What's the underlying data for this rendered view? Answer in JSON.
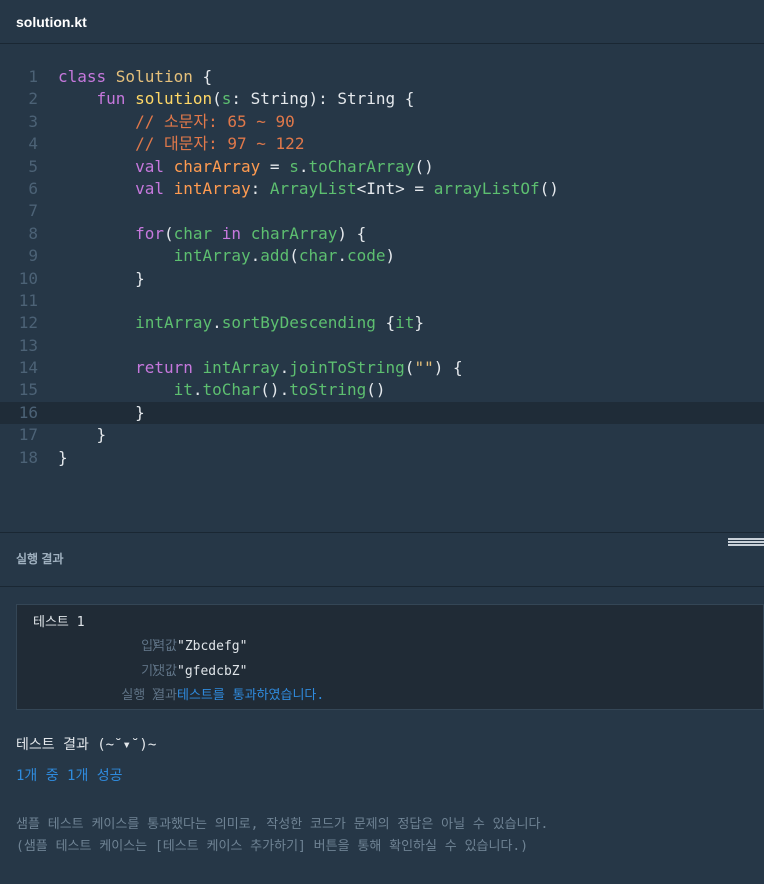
{
  "header": {
    "file_name": "solution.kt"
  },
  "editor": {
    "active_line": "16",
    "line_numbers": [
      "1",
      "2",
      "3",
      "4",
      "5",
      "6",
      "7",
      "8",
      "9",
      "10",
      "11",
      "12",
      "13",
      "14",
      "15",
      "16",
      "17",
      "18"
    ],
    "lines": [
      [
        {
          "t": "class ",
          "c": "kw"
        },
        {
          "t": "Solution",
          "c": "cls"
        },
        {
          "t": " {",
          "c": ""
        }
      ],
      [
        {
          "t": "    ",
          "c": ""
        },
        {
          "t": "fun ",
          "c": "kw"
        },
        {
          "t": "solution",
          "c": "fn"
        },
        {
          "t": "(",
          "c": ""
        },
        {
          "t": "s",
          "c": "mth"
        },
        {
          "t": ": String): String {",
          "c": ""
        }
      ],
      [
        {
          "t": "        // 소문자: 65 ~ 90",
          "c": "cmt"
        }
      ],
      [
        {
          "t": "        // 대문자: 97 ~ 122",
          "c": "cmt"
        }
      ],
      [
        {
          "t": "        ",
          "c": ""
        },
        {
          "t": "val ",
          "c": "kw"
        },
        {
          "t": "charArray",
          "c": "var"
        },
        {
          "t": " = ",
          "c": ""
        },
        {
          "t": "s",
          "c": "mth"
        },
        {
          "t": ".",
          "c": ""
        },
        {
          "t": "toCharArray",
          "c": "mth"
        },
        {
          "t": "()",
          "c": ""
        }
      ],
      [
        {
          "t": "        ",
          "c": ""
        },
        {
          "t": "val ",
          "c": "kw"
        },
        {
          "t": "intArray",
          "c": "var"
        },
        {
          "t": ": ",
          "c": ""
        },
        {
          "t": "ArrayList",
          "c": "mth"
        },
        {
          "t": "<Int> = ",
          "c": ""
        },
        {
          "t": "arrayListOf",
          "c": "mth"
        },
        {
          "t": "()",
          "c": ""
        }
      ],
      [],
      [
        {
          "t": "        ",
          "c": ""
        },
        {
          "t": "for",
          "c": "kw"
        },
        {
          "t": "(",
          "c": ""
        },
        {
          "t": "char ",
          "c": "mth"
        },
        {
          "t": "in ",
          "c": "kw"
        },
        {
          "t": "charArray",
          "c": "mth"
        },
        {
          "t": ") {",
          "c": ""
        }
      ],
      [
        {
          "t": "            ",
          "c": ""
        },
        {
          "t": "intArray",
          "c": "mth"
        },
        {
          "t": ".",
          "c": ""
        },
        {
          "t": "add",
          "c": "mth"
        },
        {
          "t": "(",
          "c": ""
        },
        {
          "t": "char",
          "c": "mth"
        },
        {
          "t": ".",
          "c": ""
        },
        {
          "t": "code",
          "c": "mth"
        },
        {
          "t": ")",
          "c": ""
        }
      ],
      [
        {
          "t": "        }",
          "c": ""
        }
      ],
      [],
      [
        {
          "t": "        ",
          "c": ""
        },
        {
          "t": "intArray",
          "c": "mth"
        },
        {
          "t": ".",
          "c": ""
        },
        {
          "t": "sortByDescending",
          "c": "mth"
        },
        {
          "t": " {",
          "c": ""
        },
        {
          "t": "it",
          "c": "mth"
        },
        {
          "t": "}",
          "c": ""
        }
      ],
      [],
      [
        {
          "t": "        ",
          "c": ""
        },
        {
          "t": "return ",
          "c": "kw"
        },
        {
          "t": "intArray",
          "c": "mth"
        },
        {
          "t": ".",
          "c": ""
        },
        {
          "t": "joinToString",
          "c": "mth"
        },
        {
          "t": "(",
          "c": ""
        },
        {
          "t": "\"\"",
          "c": "str"
        },
        {
          "t": ") {",
          "c": ""
        }
      ],
      [
        {
          "t": "            ",
          "c": ""
        },
        {
          "t": "it",
          "c": "mth"
        },
        {
          "t": ".",
          "c": ""
        },
        {
          "t": "toChar",
          "c": "mth"
        },
        {
          "t": "().",
          "c": ""
        },
        {
          "t": "toString",
          "c": "mth"
        },
        {
          "t": "()",
          "c": ""
        }
      ],
      [
        {
          "t": "        }",
          "c": ""
        }
      ],
      [
        {
          "t": "    }",
          "c": ""
        }
      ],
      [
        {
          "t": "}",
          "c": ""
        }
      ]
    ],
    "colors": {
      "keyword": "#c678dd",
      "class": "#e5c07b",
      "function": "#ffd866",
      "comment": "#e0784a",
      "method": "#5dbf70",
      "variable": "#ff9b50"
    }
  },
  "results_panel": {
    "title": "실행 결과",
    "test_case": {
      "title": "테스트 1",
      "rows": [
        {
          "label": "입력값",
          "value": "\"Zbcdefg\""
        },
        {
          "label": "기댓값",
          "value": "\"gfedcbZ\""
        },
        {
          "label": "실행 결과",
          "value": "테스트를 통과하였습니다."
        }
      ]
    },
    "result_title": "테스트 결과 (~˘▾˘)~",
    "result_summary": "1개 중 1개 성공",
    "notes": [
      "샘플 테스트 케이스를 통과했다는 의미로, 작성한 코드가 문제의 정답은 아닐 수 있습니다.",
      "(샘플 테스트 케이스는 [테스트 케이스 추가하기] 버튼을 통해 확인하실 수 있습니다.)"
    ],
    "chevron": "〉",
    "pass_color": "#2f8bde"
  }
}
